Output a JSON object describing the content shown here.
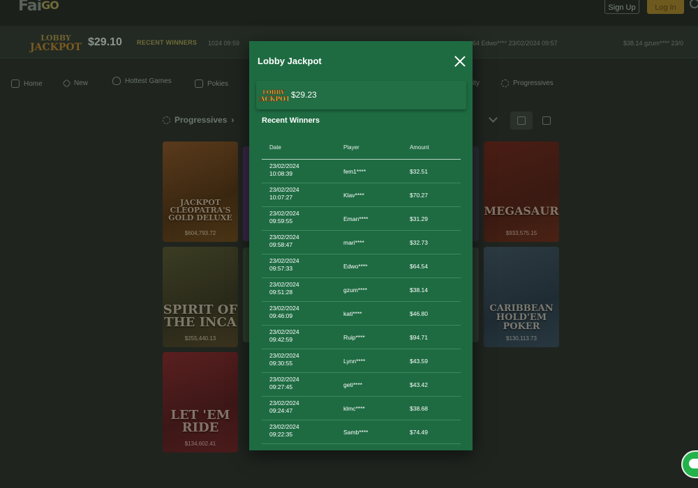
{
  "background": {
    "logo": {
      "text": "Fai",
      "accent": "GO"
    },
    "auth": {
      "signup_label": "Sign Up",
      "login_label": "Log In"
    },
    "ticker": {
      "logo_line1": "LOBBY",
      "logo_line2": "JACKPOT",
      "amount": "$29.10",
      "recent_label": "RECENT WINNERS",
      "entries": [
        "1024 09:59",
        "64 Edwo**** 23/02/2024 09:57",
        "$38.14 gzum**** 23/0"
      ]
    },
    "nav": [
      {
        "label": "Home",
        "icon": "home-icon"
      },
      {
        "label": "New",
        "icon": "diamond-icon"
      },
      {
        "label": "Hottest Games",
        "icon": "flame-icon"
      },
      {
        "label": "Pokies",
        "icon": "slot-icon"
      },
      {
        "label": "ity",
        "icon": ""
      },
      {
        "label": "Progressives",
        "icon": "sun-icon"
      }
    ],
    "section_title": "Progressives",
    "games": [
      {
        "title": "JACKPOT CLEOPATRA'S GOLD DELUXE",
        "jackpot": "$604,793.72"
      },
      {
        "title": "SPIRIT OF THE INCA",
        "jackpot": "$255,440.13"
      },
      {
        "title": "LET 'EM RIDE",
        "jackpot": "$134,602.41"
      },
      {
        "title": "MEGASAUR",
        "jackpot": "$933,575.15"
      },
      {
        "title": "CARIBBEAN HOLD'EM POKER",
        "jackpot": "$130,113.73"
      }
    ]
  },
  "modal": {
    "title": "Lobby Jackpot",
    "jackpot_logo_line1": "LOBBY",
    "jackpot_logo_line2": "JACKPOT",
    "jackpot_amount": "$29.23",
    "recent_title": "Recent Winners",
    "columns": {
      "date": "Date",
      "player": "Player",
      "amount": "Amount"
    },
    "winners": [
      {
        "date": "23/02/2024",
        "time": "10:08:39",
        "player": "fem1****",
        "amount": "$32.51"
      },
      {
        "date": "23/02/2024",
        "time": "10:07:27",
        "player": "Klav****",
        "amount": "$70.27"
      },
      {
        "date": "23/02/2024",
        "time": "09:59:55",
        "player": "Eman****",
        "amount": "$31.29"
      },
      {
        "date": "23/02/2024",
        "time": "09:58:47",
        "player": "mari****",
        "amount": "$32.73"
      },
      {
        "date": "23/02/2024",
        "time": "09:57:33",
        "player": "Edwo****",
        "amount": "$64.54"
      },
      {
        "date": "23/02/2024",
        "time": "09:51:28",
        "player": "gzum****",
        "amount": "$38.14"
      },
      {
        "date": "23/02/2024",
        "time": "09:46:09",
        "player": "kati****",
        "amount": "$46.80"
      },
      {
        "date": "23/02/2024",
        "time": "09:42:59",
        "player": "Ruip****",
        "amount": "$94.71"
      },
      {
        "date": "23/02/2024",
        "time": "09:30:55",
        "player": "Lynn****",
        "amount": "$43.59"
      },
      {
        "date": "23/02/2024",
        "time": "09:27:45",
        "player": "geti****",
        "amount": "$43.42"
      },
      {
        "date": "23/02/2024",
        "time": "09:24:47",
        "player": "klmc****",
        "amount": "$38.68"
      },
      {
        "date": "23/02/2024",
        "time": "09:22:35",
        "player": "Samb****",
        "amount": "$74.49"
      }
    ]
  },
  "colors": {
    "modal_bg": "#1e6b42",
    "page_bg": "#1f241f",
    "chat_button": "#23b34a"
  }
}
